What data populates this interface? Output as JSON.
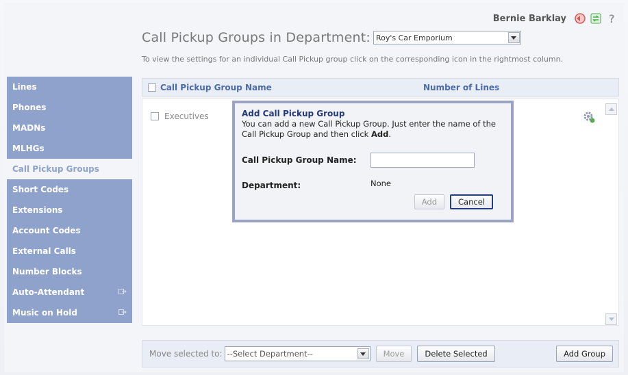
{
  "header": {
    "user_name": "Bernie Barklay",
    "title": "Call Pickup Groups in Department:",
    "department_selected": "Roy's Car Emporium",
    "hint": "To view the settings for an individual Call Pickup group click on the corresponding icon in the rightmost column.",
    "icons": [
      "logout-icon",
      "refresh-icon",
      "help-icon"
    ]
  },
  "sidebar": {
    "items": [
      {
        "label": "Lines"
      },
      {
        "label": "Phones"
      },
      {
        "label": "MADNs"
      },
      {
        "label": "MLHGs"
      },
      {
        "label": "Call Pickup Groups",
        "active": true
      },
      {
        "label": "Short Codes"
      },
      {
        "label": "Extensions"
      },
      {
        "label": "Account Codes"
      },
      {
        "label": "External Calls"
      },
      {
        "label": "Number Blocks"
      },
      {
        "label": "Auto-Attendant",
        "external": true
      },
      {
        "label": "Music on Hold",
        "external": true
      }
    ]
  },
  "table": {
    "columns": [
      "Call Pickup Group Name",
      "Number of Lines"
    ],
    "rows": [
      {
        "name": "Executives"
      }
    ]
  },
  "modal": {
    "title": "Add Call Pickup Group",
    "description": "You can add a new Call Pickup Group. Just enter the name of the Call Pickup Group and then click",
    "description_bold": "Add",
    "description_end": ".",
    "name_label": "Call Pickup Group Name:",
    "name_value": "",
    "department_label": "Department:",
    "department_value": "None",
    "add_label": "Add",
    "cancel_label": "Cancel"
  },
  "footer": {
    "move_label": "Move selected to:",
    "move_placeholder": "--Select Department--",
    "move_button": "Move",
    "delete_button": "Delete Selected",
    "add_group_button": "Add Group"
  },
  "colors": {
    "sidebar_bg": "#8fa2cc",
    "title_blue": "#23397a",
    "header_blue": "#4a6aa8"
  }
}
